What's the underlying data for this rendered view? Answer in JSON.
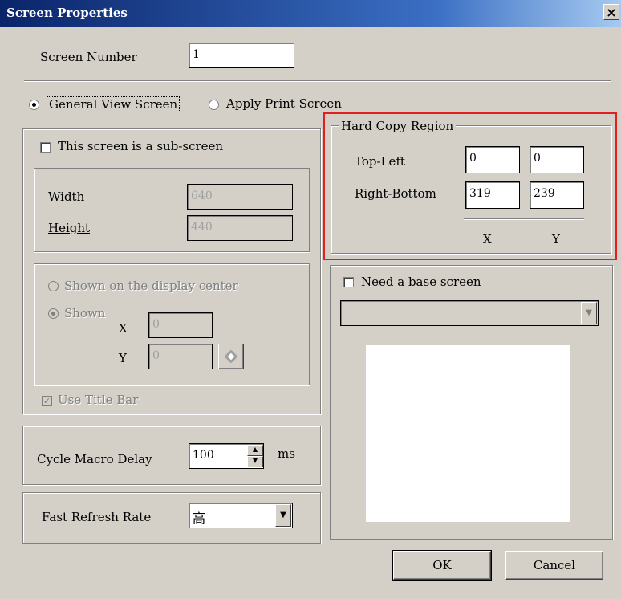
{
  "window": {
    "title": "Screen Properties",
    "close_glyph": "×"
  },
  "screen_number": {
    "label": "Screen Number",
    "value": "1"
  },
  "view_mode": {
    "general": "General View Screen",
    "print": "Apply Print Screen"
  },
  "sub_screen": {
    "checkbox_label": "This screen is a sub-screen",
    "width_label": "Width",
    "width_value": "640",
    "height_label": "Height",
    "height_value": "440",
    "center_label": "Shown on the display center",
    "shown_label": "Shown",
    "x_label": "X",
    "x_value": "0",
    "y_label": "Y",
    "y_value": "0",
    "title_bar_label": "Use Title Bar"
  },
  "cycle_macro": {
    "label": "Cycle Macro Delay",
    "value": "100",
    "unit": "ms"
  },
  "fast_refresh": {
    "label": "Fast Refresh Rate",
    "value": "高"
  },
  "hard_copy": {
    "legend": "Hard Copy Region",
    "top_left_label": "Top-Left",
    "top_left_x": "0",
    "top_left_y": "0",
    "right_bottom_label": "Right-Bottom",
    "right_bottom_x": "319",
    "right_bottom_y": "239",
    "x_header": "X",
    "y_header": "Y"
  },
  "base_screen": {
    "label": "Need a base screen",
    "selected": ""
  },
  "buttons": {
    "ok": "OK",
    "cancel": "Cancel"
  },
  "icons": {
    "close": "close-icon",
    "picker": "pick-position-icon",
    "dropdown": "chevron-down-icon"
  },
  "colors": {
    "dialog_bg": "#d4d0c8",
    "titlebar": "#0a246a",
    "highlight": "#e02020"
  }
}
